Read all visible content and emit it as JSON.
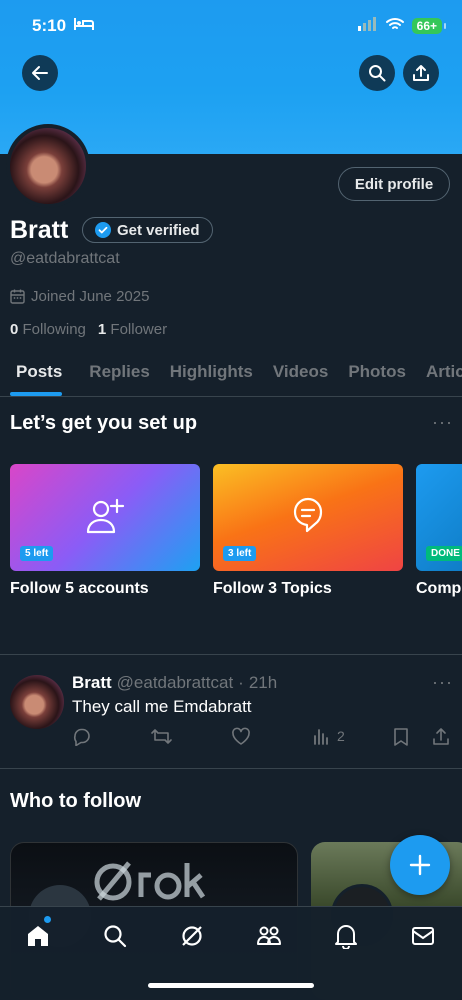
{
  "status_bar": {
    "time": "5:10",
    "battery": "66+"
  },
  "profile": {
    "name": "Bratt",
    "get_verified": "Get verified",
    "handle": "@eatdabrattcat",
    "joined": "Joined June 2025",
    "following_count": "0",
    "following_label": "Following",
    "followers_count": "1",
    "followers_label": "Follower",
    "edit_profile": "Edit profile"
  },
  "tabs": [
    "Posts",
    "Replies",
    "Highlights",
    "Videos",
    "Photos",
    "Articles"
  ],
  "setup": {
    "title": "Let’s get you set up",
    "cards": [
      {
        "badge": "5 left",
        "label": "Follow 5 accounts",
        "icon": "add-user-icon"
      },
      {
        "badge": "3 left",
        "label": "Follow 3 Topics",
        "icon": "topic-icon"
      },
      {
        "badge": "DONE",
        "label": "Complete your profile"
      }
    ]
  },
  "post": {
    "name": "Bratt",
    "handle": "@eatdabrattcat",
    "separator": "·",
    "time": "21h",
    "text": "They call me Emdabratt",
    "views": "2"
  },
  "who_to_follow": {
    "title": "Who to follow"
  },
  "colors": {
    "accent": "#1d9bf0",
    "background": "#15202b",
    "muted": "#71767b",
    "border": "#38444d"
  }
}
